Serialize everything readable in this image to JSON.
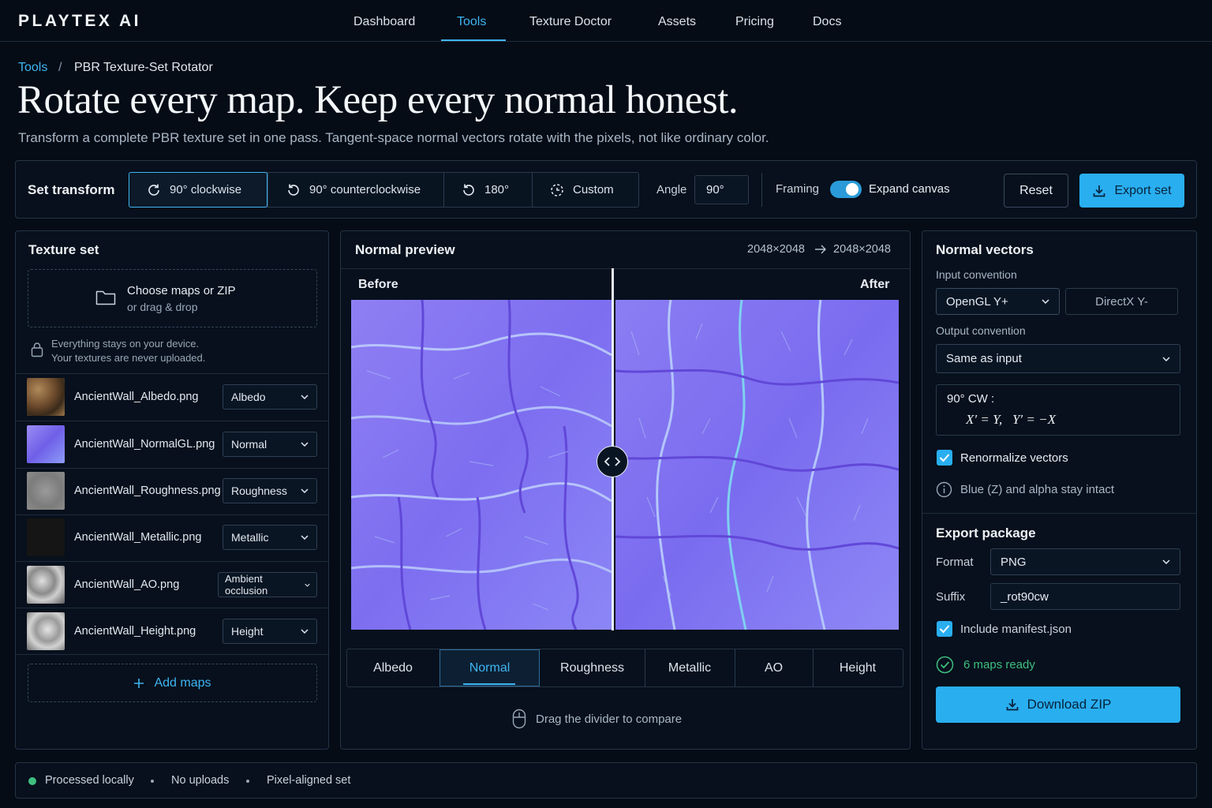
{
  "app": {
    "logo": "PLAYTEX AI"
  },
  "nav": {
    "items": [
      "Dashboard",
      "Tools",
      "Texture Doctor",
      "Assets",
      "Pricing",
      "Docs"
    ],
    "active": "Tools"
  },
  "breadcrumb": {
    "parent": "Tools",
    "separator": "/",
    "current": "PBR Texture-Set Rotator"
  },
  "header": {
    "title": "Rotate every map. Keep every normal honest.",
    "subtitle": "Transform a complete PBR texture set in one pass. Tangent-space normal vectors rotate with the pixels, not like ordinary color."
  },
  "toolbar": {
    "label": "Set transform",
    "options": [
      {
        "label": "90° clockwise",
        "icon": "rotate-cw-icon",
        "active": true
      },
      {
        "label": "90° counterclockwise",
        "icon": "rotate-ccw-icon",
        "active": false
      },
      {
        "label": "180°",
        "icon": "rotate-180-icon",
        "active": false
      },
      {
        "label": "Custom",
        "icon": "custom-rotate-icon",
        "active": false
      }
    ],
    "angle_label": "Angle",
    "angle_value": "90°",
    "framing_label": "Framing",
    "expand_canvas_label": "Expand canvas",
    "expand_canvas_on": true,
    "reset_label": "Reset",
    "export_label": "Export set"
  },
  "texture_set": {
    "title": "Texture set",
    "upload": {
      "primary": "Choose maps or ZIP",
      "secondary": "or drag & drop"
    },
    "privacy": {
      "line1": "Everything stays on your device.",
      "line2": "Your textures are never uploaded."
    },
    "files": [
      {
        "name": "AncientWall_Albedo.png",
        "type": "Albedo"
      },
      {
        "name": "AncientWall_NormalGL.png",
        "type": "Normal"
      },
      {
        "name": "AncientWall_Roughness.png",
        "type": "Roughness"
      },
      {
        "name": "AncientWall_Metallic.png",
        "type": "Metallic"
      },
      {
        "name": "AncientWall_AO.png",
        "type": "Ambient occlusion"
      },
      {
        "name": "AncientWall_Height.png",
        "type": "Height"
      }
    ],
    "add_label": "Add maps"
  },
  "preview": {
    "title": "Normal preview",
    "res_in": "2048×2048",
    "res_out": "2048×2048",
    "before_label": "Before",
    "after_label": "After",
    "tabs": [
      "Albedo",
      "Normal",
      "Roughness",
      "Metallic",
      "AO",
      "Height"
    ],
    "active_tab": "Normal",
    "hint": "Drag the divider to compare"
  },
  "normals": {
    "title": "Normal vectors",
    "input_label": "Input convention",
    "input_selected": "OpenGL Y+",
    "input_alt": "DirectX Y-",
    "output_label": "Output convention",
    "output_value": "Same as input",
    "formula_label": "90° CW :",
    "formula": "X′ = Y,   Y′ = −X",
    "renormalize_label": "Renormalize vectors",
    "renormalize_checked": true,
    "info": "Blue (Z) and alpha stay intact"
  },
  "export": {
    "title": "Export package",
    "format_label": "Format",
    "format_value": "PNG",
    "suffix_label": "Suffix",
    "suffix_value": "_rot90cw",
    "manifest_label": "Include manifest.json",
    "manifest_checked": true,
    "status": "6 maps ready",
    "download_label": "Download ZIP"
  },
  "footer": {
    "items": [
      "Processed locally",
      "No uploads",
      "Pixel-aligned set"
    ]
  },
  "colors": {
    "accent": "#29aef0",
    "link": "#3fb4f2",
    "success": "#3fbf7f",
    "background": "#050c16",
    "normal_map": "#8a7cf0"
  }
}
